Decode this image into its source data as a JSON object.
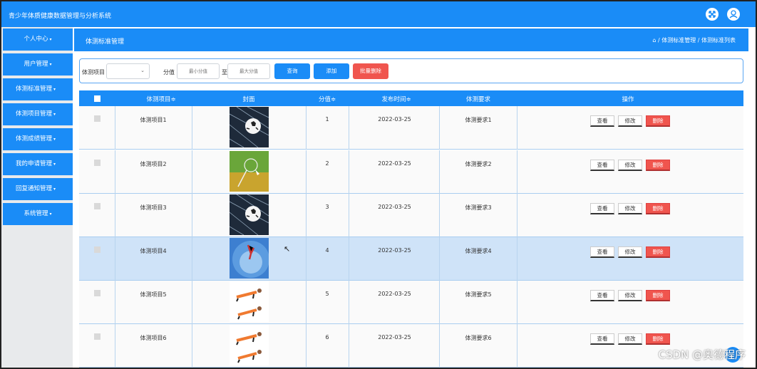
{
  "app": {
    "title": "青少年体质健康数据管理与分析系统"
  },
  "topbar_icons": [
    "fullscreen-icon",
    "user-icon"
  ],
  "sidebar": {
    "items": [
      {
        "label": "个人中心"
      },
      {
        "label": "用户管理"
      },
      {
        "label": "体测标准管理"
      },
      {
        "label": "体测项目管理"
      },
      {
        "label": "体测成绩管理"
      },
      {
        "label": "我的申请管理"
      },
      {
        "label": "回复通知管理"
      },
      {
        "label": "系统管理"
      }
    ]
  },
  "header": {
    "title": "体测标准管理",
    "breadcrumb": "/ 体测标准管理 / 体测标准列表"
  },
  "search": {
    "project_label": "体测项目",
    "score_label": "分值",
    "min_placeholder": "最小分值",
    "to_label": "至",
    "max_placeholder": "最大分值",
    "query_btn": "查询",
    "add_btn": "添加",
    "batch_delete_btn": "批量删除"
  },
  "table": {
    "headers": [
      "体测项目≑",
      "封面",
      "分值≑",
      "发布时间≑",
      "体测要求",
      "操作"
    ],
    "actions": {
      "view": "查看",
      "edit": "修改",
      "delete": "删除"
    },
    "rows": [
      {
        "project": "体测项目1",
        "cover": "soccer",
        "score": "1",
        "date": "2022-03-25",
        "req": "体测要求1"
      },
      {
        "project": "体测项目2",
        "cover": "badminton",
        "score": "2",
        "date": "2022-03-25",
        "req": "体测要求2"
      },
      {
        "project": "体测项目3",
        "cover": "soccer",
        "score": "3",
        "date": "2022-03-25",
        "req": "体测要求3"
      },
      {
        "project": "体测项目4",
        "cover": "skydiver",
        "score": "4",
        "date": "2022-03-25",
        "req": "体测要求4"
      },
      {
        "project": "体测项目5",
        "cover": "plank",
        "score": "5",
        "date": "2022-03-25",
        "req": "体测要求5"
      },
      {
        "project": "体测项目6",
        "cover": "plank",
        "score": "6",
        "date": "2022-03-25",
        "req": "体测要求6"
      }
    ]
  },
  "watermark": "CSDN @奥德程序",
  "colors": {
    "primary": "#1a8cf7",
    "danger": "#f0554e",
    "selected_row": "#cfe3f8"
  }
}
